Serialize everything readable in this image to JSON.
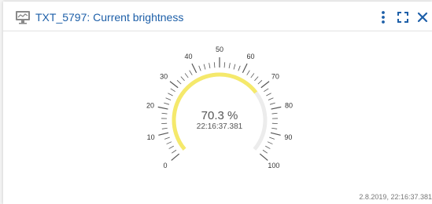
{
  "widget": {
    "title": "TXT_5797: Current brightness",
    "icon": "chart-monitor-icon",
    "actions": [
      {
        "name": "more-options-button",
        "icon": "kebab-menu-icon"
      },
      {
        "name": "fullscreen-button",
        "icon": "expand-icon"
      },
      {
        "name": "close-button",
        "icon": "close-icon"
      }
    ],
    "accent_color": "#1d5fa8",
    "footer_timestamp": "2.8.2019, 22:16:37.381"
  },
  "gauge": {
    "min": 0,
    "max": 100,
    "value": 70.3,
    "value_label": "70.3 %",
    "time_label": "22:16:37.381",
    "major_ticks": [
      "0",
      "10",
      "20",
      "30",
      "40",
      "50",
      "60",
      "70",
      "80",
      "90",
      "100"
    ],
    "fill_color": "#f5e96b",
    "track_color": "#ececec"
  }
}
